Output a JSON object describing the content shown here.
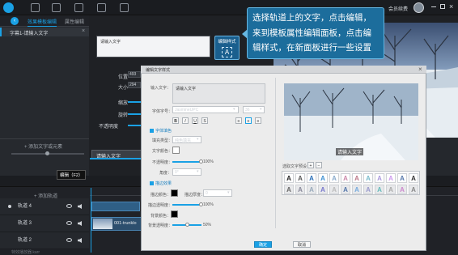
{
  "tabs": {
    "active": "效果模板编辑",
    "inactive": "属性编辑"
  },
  "left": {
    "subtitle_item": "字幕1-请输入文字",
    "add_element": "+ 添加文字或元素"
  },
  "props": {
    "position_label": "位置",
    "position_val": "493",
    "size_label": "大小",
    "size_val": "294",
    "scale_label": "缩放",
    "rotate_label": "旋转",
    "opacity_label": "不透明度"
  },
  "text_box": {
    "value": "请输入文字"
  },
  "edit_style": {
    "label": "编辑样式",
    "glyph": "A"
  },
  "callout": {
    "line1": "选择轨道上的文字，点击编辑，",
    "line2": "来到模板属性编辑面板，点击编",
    "line3": "辑样式，在新面板进行一些设置"
  },
  "tooltip": {
    "text": "编辑（F2）"
  },
  "dialog": {
    "title": "编辑文字样式",
    "input_label": "输入文字：",
    "input_value": "请输入文字",
    "font_label": "字体字号：",
    "font_value": "JasmineUPC",
    "size_value": "36",
    "bold": "B",
    "italic": "I",
    "underline": "U",
    "strike": "S",
    "align_left": "≡",
    "align_center": "≡",
    "align_right": "≡",
    "section_font": "字体填色",
    "fill_type_label": "填充类型：",
    "fill_type_value": "纯色填充",
    "text_color_label": "文字颜色：",
    "opacity_label": "不透明度：",
    "opacity_value": "100%",
    "angle_label": "角度：",
    "angle_value": "0°",
    "section_border": "描边效果",
    "stroke_color_label": "描边颜色：",
    "stroke_width_label": "描边厚度：",
    "stroke_width_value": "0",
    "stroke_opacity_label": "描边透明度：",
    "stroke_opacity_value": "100%",
    "bg_color_label": "背景颜色：",
    "bg_opacity_label": "背景透明度：",
    "bg_opacity_value": "50%",
    "preset_label": "选取文字预设：",
    "preview_caption": "请输入文字",
    "ok": "确定",
    "cancel": "取消",
    "preset_glyph": "A"
  },
  "preview_caption": "请输入文字",
  "timeline": {
    "add_track": "+ 添加轨道",
    "clip_text": "请输入文字",
    "video_clip": "001-trunklo",
    "tracks": [
      {
        "name": "轨道 4"
      },
      {
        "name": "轨道 3"
      },
      {
        "name": "轨道 2"
      }
    ],
    "bottom_text": "特效播放器.karr"
  },
  "user": {
    "name": "会员续费"
  },
  "colors": {
    "accent": "#1aa1e5",
    "callout": "#1c6d9c",
    "dialog_bg": "#ececec"
  }
}
